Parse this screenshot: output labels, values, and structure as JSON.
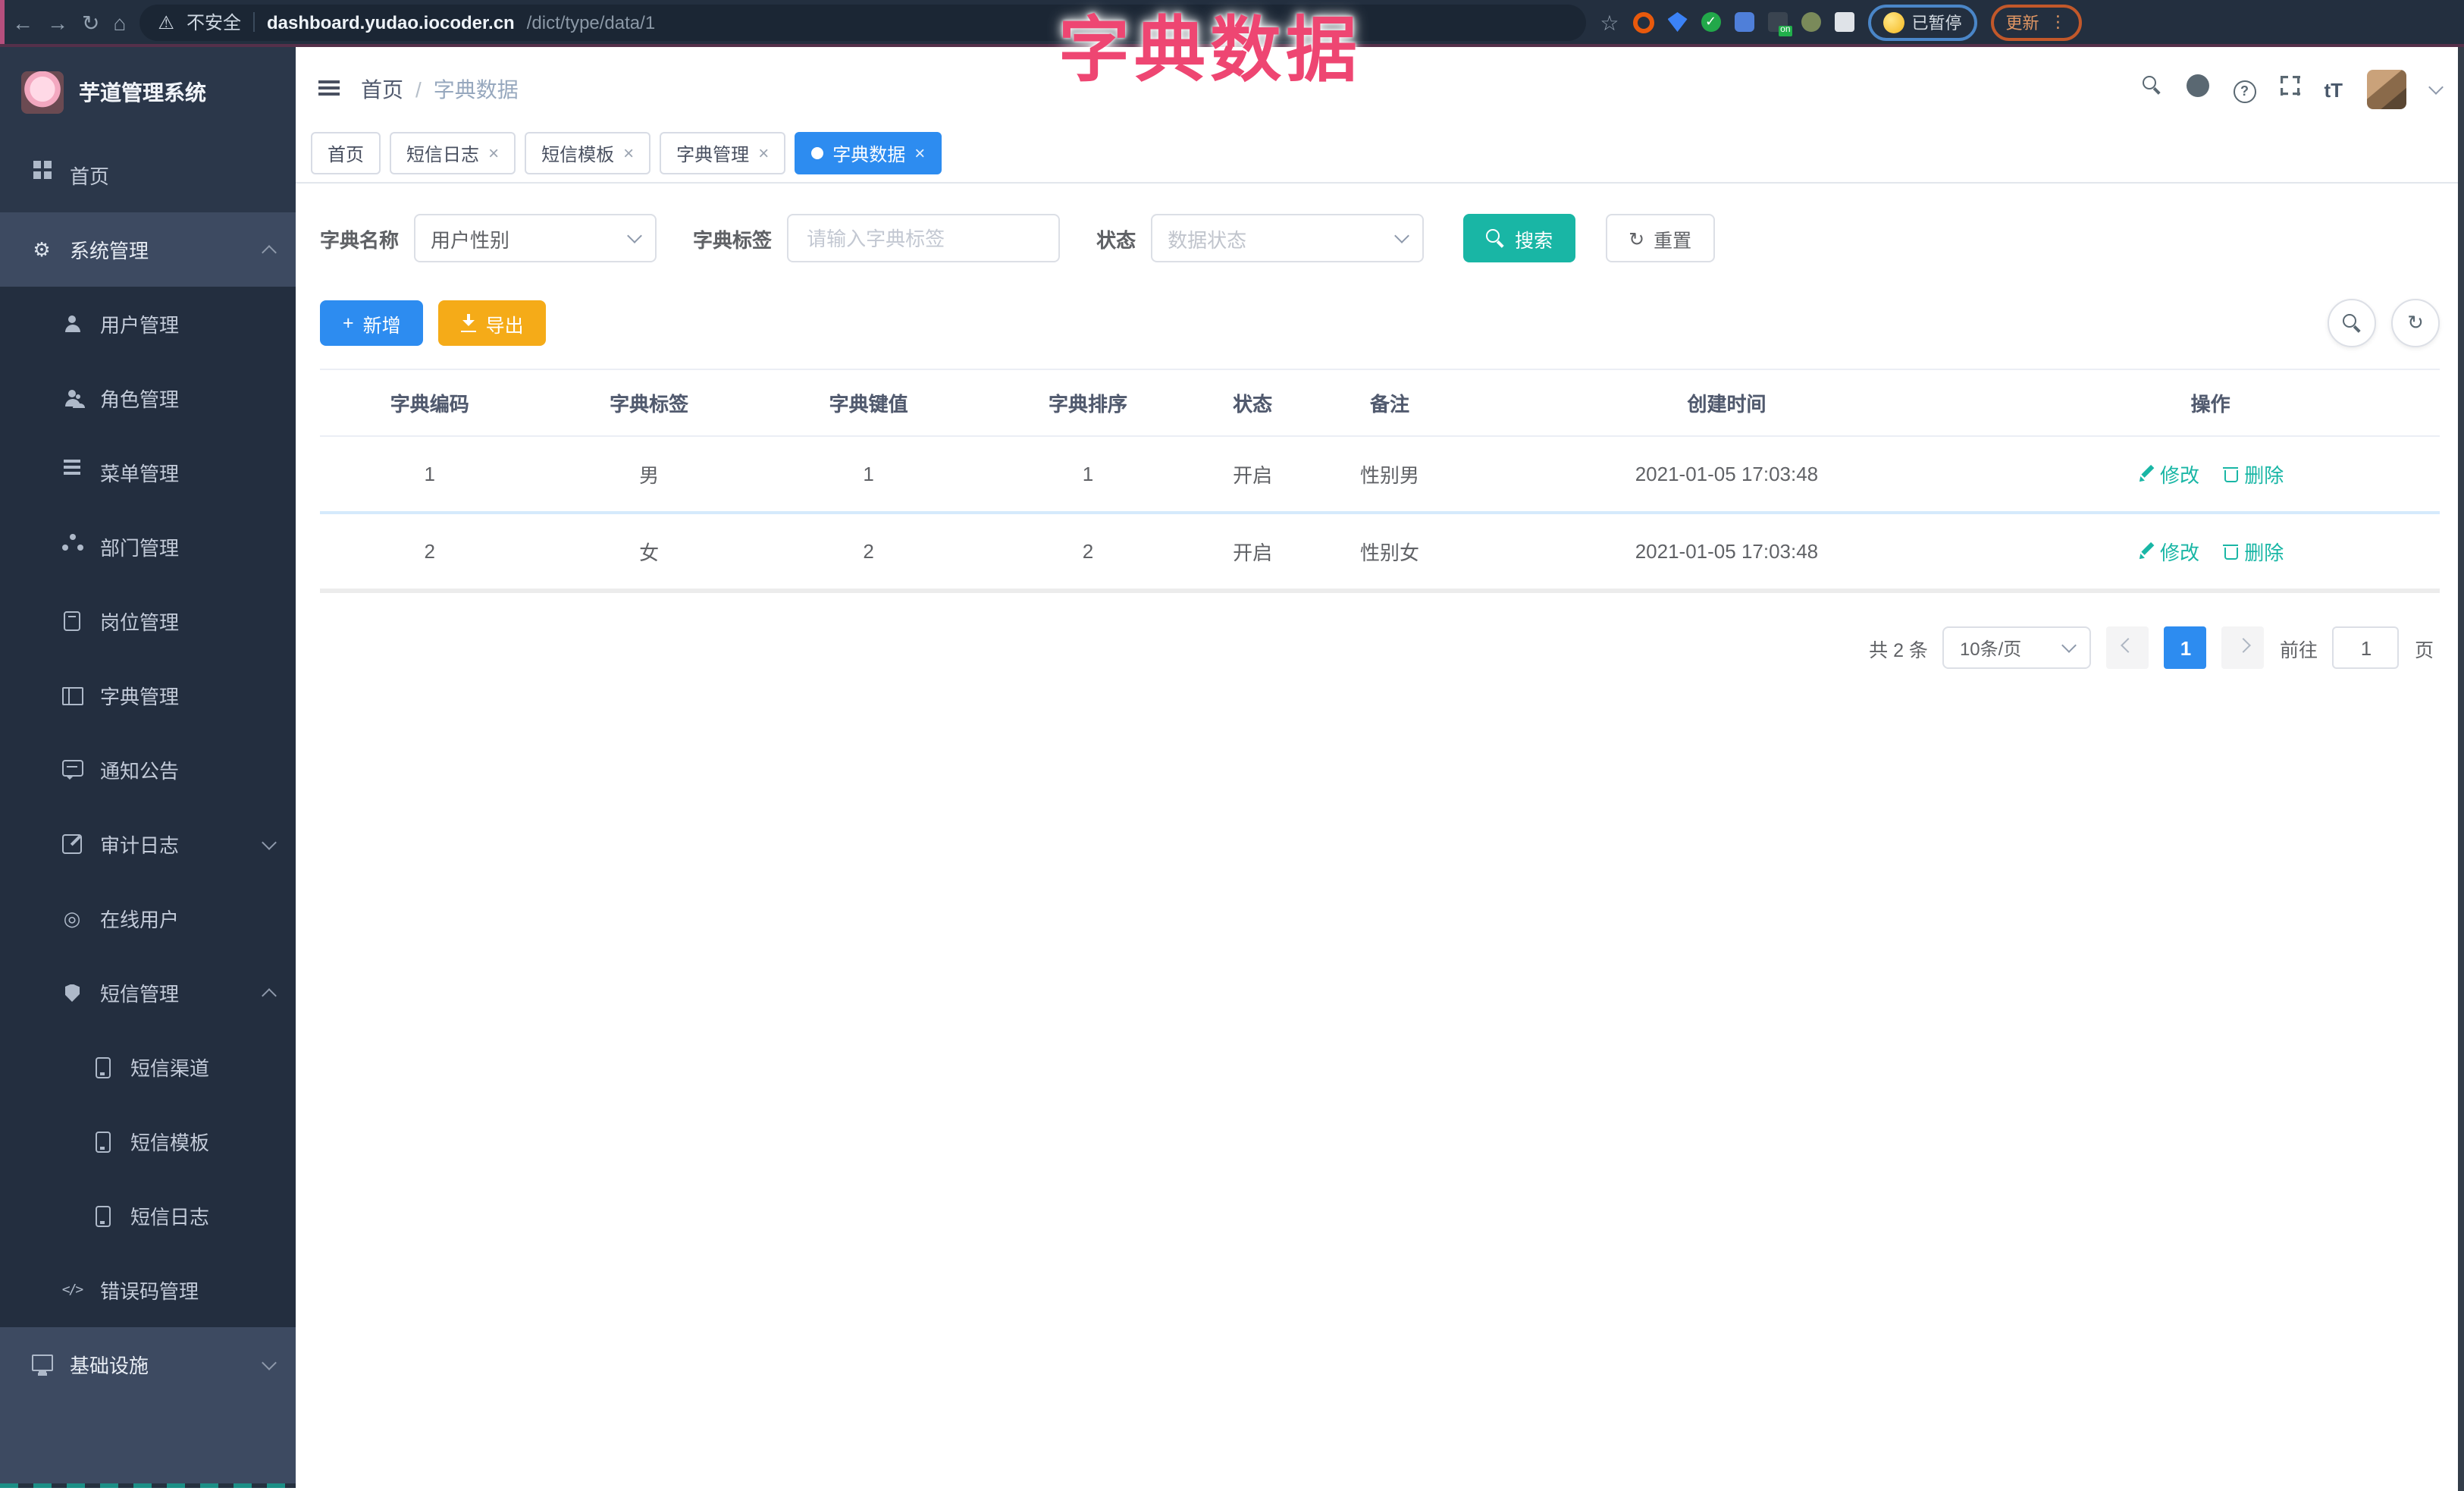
{
  "browser": {
    "security_label": "不安全",
    "url_host": "dashboard.yudao.iocoder.cn",
    "url_path": "/dict/type/data/1",
    "ext_on_badge": "on",
    "paused_label": "已暂停",
    "update_label": "更新"
  },
  "overlay": {
    "title": "字典数据",
    "color": "#ee4672"
  },
  "sidebar": {
    "app_title": "芋道管理系统",
    "items": [
      {
        "label": "首页"
      },
      {
        "label": "系统管理"
      },
      {
        "label": "用户管理"
      },
      {
        "label": "角色管理"
      },
      {
        "label": "菜单管理"
      },
      {
        "label": "部门管理"
      },
      {
        "label": "岗位管理"
      },
      {
        "label": "字典管理"
      },
      {
        "label": "通知公告"
      },
      {
        "label": "审计日志"
      },
      {
        "label": "在线用户"
      },
      {
        "label": "短信管理"
      },
      {
        "label": "短信渠道"
      },
      {
        "label": "短信模板"
      },
      {
        "label": "短信日志"
      },
      {
        "label": "错误码管理"
      },
      {
        "label": "基础设施"
      }
    ]
  },
  "header": {
    "breadcrumb_home": "首页",
    "breadcrumb_sep": "/",
    "breadcrumb_current": "字典数据",
    "font_icon_label": "tT"
  },
  "tabs": [
    {
      "label": "首页"
    },
    {
      "label": "短信日志"
    },
    {
      "label": "短信模板"
    },
    {
      "label": "字典管理"
    },
    {
      "label": "字典数据"
    }
  ],
  "filters": {
    "name_label": "字典名称",
    "name_value": "用户性别",
    "tag_label": "字典标签",
    "tag_placeholder": "请输入字典标签",
    "status_label": "状态",
    "status_placeholder": "数据状态",
    "search_label": "搜索",
    "reset_label": "重置"
  },
  "toolbar": {
    "add_label": "新增",
    "export_label": "导出"
  },
  "table": {
    "columns": [
      "字典编码",
      "字典标签",
      "字典键值",
      "字典排序",
      "状态",
      "备注",
      "创建时间",
      "操作"
    ],
    "rows": [
      {
        "code": "1",
        "label": "男",
        "value": "1",
        "sort": "1",
        "status": "开启",
        "remark": "性别男",
        "time": "2021-01-05 17:03:48"
      },
      {
        "code": "2",
        "label": "女",
        "value": "2",
        "sort": "2",
        "status": "开启",
        "remark": "性别女",
        "time": "2021-01-05 17:03:48"
      }
    ],
    "edit_label": "修改",
    "delete_label": "删除"
  },
  "pagination": {
    "total_label": "共 2 条",
    "page_size": "10条/页",
    "current_page": "1",
    "goto_label": "前往",
    "page_unit": "页",
    "goto_value": "1"
  },
  "colors": {
    "accent_blue": "#2d8cf0",
    "teal": "#19b6a5",
    "orange": "#f5ab18",
    "sidebar_dark": "#2b374a"
  }
}
